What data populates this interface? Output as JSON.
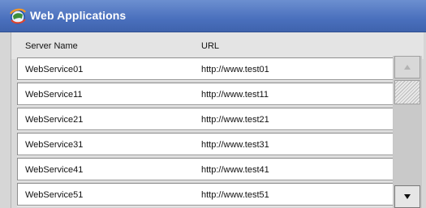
{
  "window": {
    "title": "Web Applications",
    "icon": "web-applications-icon"
  },
  "table": {
    "columns": [
      "Server Name",
      "URL"
    ],
    "rows": [
      {
        "name": "WebService01",
        "url": "http://www.test01"
      },
      {
        "name": "WebService11",
        "url": "http://www.test11"
      },
      {
        "name": "WebService21",
        "url": "http://www.test21"
      },
      {
        "name": "WebService31",
        "url": "http://www.test31"
      },
      {
        "name": "WebService41",
        "url": "http://www.test41"
      },
      {
        "name": "WebService51",
        "url": "http://www.test51"
      }
    ]
  },
  "scrollbar": {
    "up_icon": "chevron-up-icon",
    "down_icon": "chevron-down-icon",
    "up_enabled": false,
    "down_enabled": true
  },
  "colors": {
    "titlebar": "#4a70bd",
    "title_text": "#ffffff",
    "row_background": "#ffffff",
    "row_border": "#8e8e8e",
    "panel": "#d9d9d9"
  }
}
